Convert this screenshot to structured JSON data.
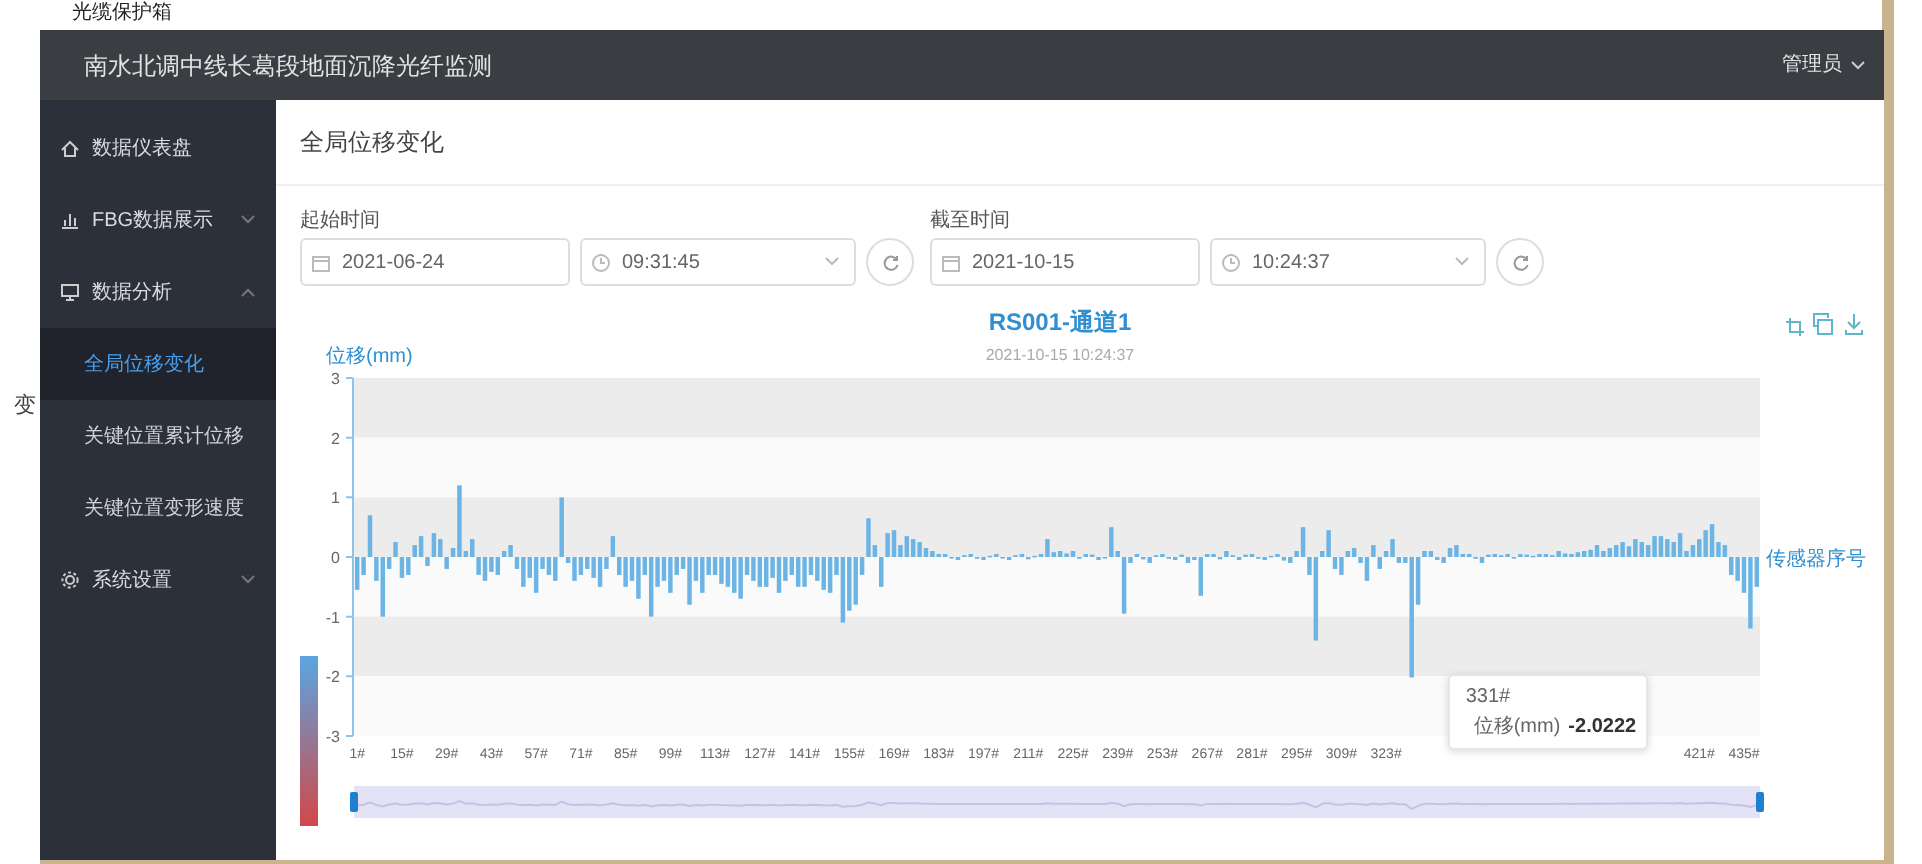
{
  "caption": "光缆保护箱",
  "stray_text": "变",
  "header": {
    "title": "南水北调中线长葛段地面沉降光纤监测",
    "user": "管理员"
  },
  "sidebar": {
    "items": [
      {
        "label": "数据仪表盘",
        "selected": false
      },
      {
        "label": "FBG数据展示",
        "selected": false,
        "expanded": false
      },
      {
        "label": "数据分析",
        "selected": false,
        "expanded": true,
        "children": [
          {
            "label": "全局位移变化",
            "selected": true
          },
          {
            "label": "关键位置累计位移",
            "selected": false
          },
          {
            "label": "关键位置变形速度",
            "selected": false
          }
        ]
      },
      {
        "label": "系统设置",
        "selected": false,
        "expanded": false
      }
    ]
  },
  "page_title": "全局位移变化",
  "filters": [
    {
      "label": "起始时间",
      "date": "2021-06-24",
      "time": "09:31:45"
    },
    {
      "label": "截至时间",
      "date": "2021-10-15",
      "time": "10:24:37"
    }
  ],
  "chart": {
    "title": "RS001-通道1",
    "subtitle": "2021-10-15 10:24:37",
    "chart_data": {
      "type": "bar",
      "ylabel": "位移(mm)",
      "xlabel": "传感器序号",
      "ylim": [
        -3,
        3
      ],
      "yticks": [
        -3,
        -2,
        -1,
        0,
        1,
        2,
        3
      ],
      "x": [
        1,
        3,
        5,
        7,
        9,
        11,
        13,
        15,
        17,
        19,
        21,
        23,
        25,
        27,
        29,
        31,
        33,
        35,
        37,
        39,
        41,
        43,
        45,
        47,
        49,
        51,
        53,
        55,
        57,
        59,
        61,
        63,
        65,
        67,
        69,
        71,
        73,
        75,
        77,
        79,
        81,
        83,
        85,
        87,
        89,
        91,
        93,
        95,
        97,
        99,
        101,
        103,
        105,
        107,
        109,
        111,
        113,
        115,
        117,
        119,
        121,
        123,
        125,
        127,
        129,
        131,
        133,
        135,
        137,
        139,
        141,
        143,
        145,
        147,
        149,
        151,
        153,
        155,
        157,
        159,
        161,
        163,
        165,
        167,
        169,
        171,
        173,
        175,
        177,
        179,
        181,
        183,
        185,
        187,
        189,
        191,
        193,
        195,
        197,
        199,
        201,
        203,
        205,
        207,
        209,
        211,
        213,
        215,
        217,
        219,
        221,
        223,
        225,
        227,
        229,
        231,
        233,
        235,
        237,
        239,
        241,
        243,
        245,
        247,
        249,
        251,
        253,
        255,
        257,
        259,
        261,
        263,
        265,
        267,
        269,
        271,
        273,
        275,
        277,
        279,
        281,
        283,
        285,
        287,
        289,
        291,
        293,
        295,
        297,
        299,
        301,
        303,
        305,
        307,
        309,
        311,
        313,
        315,
        317,
        319,
        321,
        323,
        325,
        327,
        329,
        331,
        333,
        335,
        337,
        339,
        341,
        343,
        345,
        347,
        349,
        351,
        353,
        355,
        357,
        359,
        361,
        363,
        365,
        367,
        369,
        371,
        373,
        375,
        377,
        379,
        381,
        383,
        385,
        387,
        389,
        391,
        393,
        395,
        397,
        399,
        401,
        403,
        405,
        407,
        409,
        411,
        413,
        415,
        417,
        419,
        421,
        423,
        425,
        427,
        429,
        431,
        433,
        435,
        437,
        439
      ],
      "xlim": [
        0,
        440
      ],
      "xticks": [
        {
          "value": 1,
          "label": "1#"
        },
        {
          "value": 15,
          "label": "15#"
        },
        {
          "value": 29,
          "label": "29#"
        },
        {
          "value": 43,
          "label": "43#"
        },
        {
          "value": 57,
          "label": "57#"
        },
        {
          "value": 71,
          "label": "71#"
        },
        {
          "value": 85,
          "label": "85#"
        },
        {
          "value": 99,
          "label": "99#"
        },
        {
          "value": 113,
          "label": "113#"
        },
        {
          "value": 127,
          "label": "127#"
        },
        {
          "value": 141,
          "label": "141#"
        },
        {
          "value": 155,
          "label": "155#"
        },
        {
          "value": 169,
          "label": "169#"
        },
        {
          "value": 183,
          "label": "183#"
        },
        {
          "value": 197,
          "label": "197#"
        },
        {
          "value": 211,
          "label": "211#"
        },
        {
          "value": 225,
          "label": "225#"
        },
        {
          "value": 239,
          "label": "239#"
        },
        {
          "value": 253,
          "label": "253#"
        },
        {
          "value": 267,
          "label": "267#"
        },
        {
          "value": 281,
          "label": "281#"
        },
        {
          "value": 295,
          "label": "295#"
        },
        {
          "value": 309,
          "label": "309#"
        },
        {
          "value": 323,
          "label": "323#"
        },
        {
          "value": 421,
          "label": "421#"
        },
        {
          "value": 435,
          "label": "435#"
        }
      ],
      "series": [
        {
          "name": "位移(mm)",
          "color": "#6cb4e4",
          "values": [
            -0.55,
            -0.3,
            0.7,
            -0.4,
            -1.0,
            -0.2,
            0.25,
            -0.35,
            -0.3,
            0.2,
            0.35,
            -0.15,
            0.4,
            0.3,
            -0.2,
            0.15,
            1.2,
            0.1,
            0.3,
            -0.3,
            -0.4,
            -0.25,
            -0.3,
            0.1,
            0.2,
            -0.2,
            -0.5,
            -0.35,
            -0.6,
            -0.2,
            -0.3,
            -0.4,
            1.0,
            -0.1,
            -0.4,
            -0.3,
            -0.2,
            -0.35,
            -0.5,
            -0.2,
            0.35,
            -0.3,
            -0.5,
            -0.4,
            -0.7,
            -0.3,
            -1.0,
            -0.5,
            -0.4,
            -0.6,
            -0.3,
            -0.2,
            -0.8,
            -0.4,
            -0.6,
            -0.3,
            -0.3,
            -0.45,
            -0.5,
            -0.6,
            -0.7,
            -0.3,
            -0.4,
            -0.5,
            -0.5,
            -0.35,
            -0.6,
            -0.4,
            -0.3,
            -0.5,
            -0.5,
            -0.3,
            -0.4,
            -0.55,
            -0.6,
            -0.3,
            -1.1,
            -0.9,
            -0.8,
            -0.3,
            0.65,
            0.2,
            -0.5,
            0.4,
            0.45,
            0.2,
            0.35,
            0.3,
            0.25,
            0.15,
            0.1,
            0.05,
            0.05,
            -0.02,
            -0.05,
            0.03,
            0.05,
            -0.03,
            -0.05,
            0.02,
            0.05,
            -0.02,
            -0.05,
            0.03,
            0.05,
            -0.04,
            0.02,
            0.05,
            0.3,
            0.08,
            0.1,
            0.06,
            0.1,
            -0.03,
            0.05,
            0.04,
            -0.05,
            -0.02,
            0.5,
            0.1,
            -0.95,
            -0.1,
            0.05,
            -0.04,
            -0.1,
            0.03,
            0.05,
            -0.03,
            -0.05,
            0.04,
            -0.1,
            -0.05,
            -0.65,
            0.05,
            0.05,
            -0.04,
            0.1,
            0.03,
            -0.05,
            0.04,
            0.05,
            -0.03,
            -0.05,
            0.02,
            0.05,
            -0.06,
            -0.1,
            0.1,
            0.5,
            -0.3,
            -1.4,
            0.1,
            0.45,
            -0.2,
            -0.3,
            0.1,
            0.15,
            -0.1,
            -0.4,
            0.2,
            -0.2,
            0.1,
            0.3,
            -0.1,
            -0.1,
            -2.02,
            -0.8,
            0.1,
            0.1,
            -0.05,
            -0.1,
            0.15,
            0.2,
            0.05,
            0.05,
            -0.03,
            -0.1,
            0.04,
            0.05,
            0.03,
            0.05,
            -0.02,
            0.05,
            0.04,
            0.02,
            0.05,
            0.05,
            0.03,
            0.1,
            0.06,
            0.05,
            0.08,
            0.1,
            0.12,
            0.2,
            0.1,
            0.15,
            0.2,
            0.25,
            0.18,
            0.3,
            0.25,
            0.2,
            0.35,
            0.35,
            0.3,
            0.25,
            0.4,
            0.1,
            0.2,
            0.3,
            0.45,
            0.55,
            0.25,
            0.2,
            -0.3,
            -0.4,
            -0.6,
            -1.2,
            -0.5
          ]
        }
      ]
    },
    "tooltip": {
      "title": "331#",
      "value": "-2.0222"
    }
  }
}
